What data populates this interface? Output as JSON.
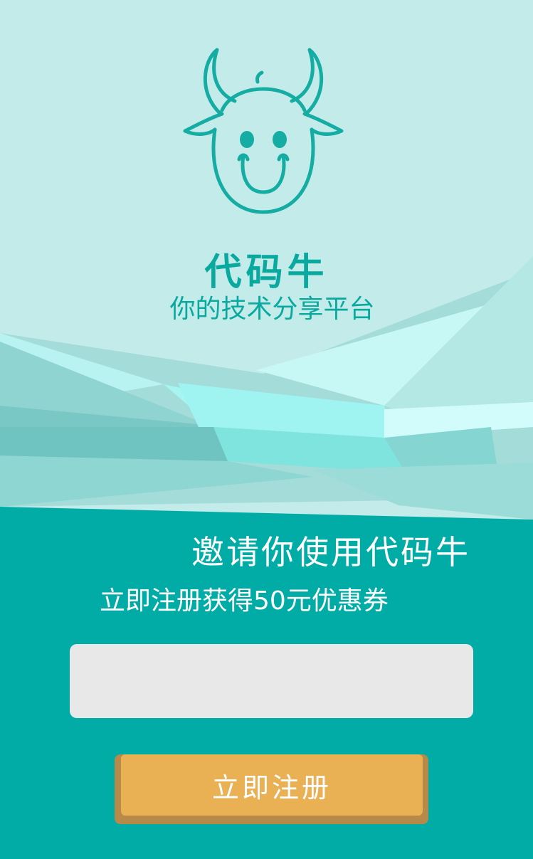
{
  "brand": {
    "name": "代码牛",
    "slogan": "你的技术分享平台"
  },
  "invite": {
    "headline": "邀请你使用代码牛",
    "offer": "立即注册获得50元优惠券"
  },
  "form": {
    "phone_value": "",
    "register_label": "立即注册"
  },
  "colors": {
    "top_background": "#c3ebea",
    "bottom_background": "#02aca6",
    "brand_teal": "#0aa9a0",
    "button": "#eab054",
    "input_background": "#e8e8e8"
  },
  "icons": {
    "logo": "cow-head-icon"
  }
}
